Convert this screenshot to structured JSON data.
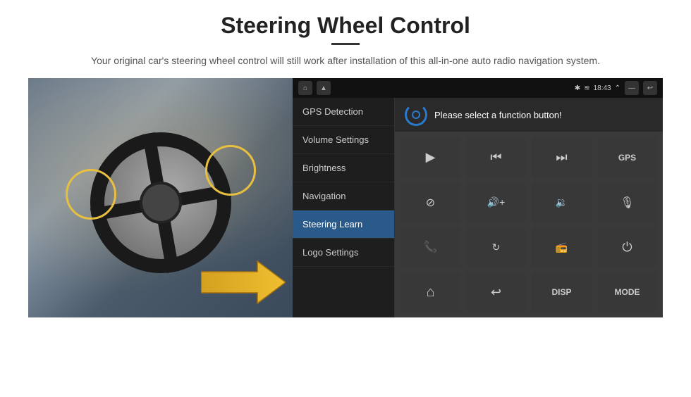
{
  "header": {
    "title": "Steering Wheel Control",
    "subtitle": "Your original car's steering wheel control will still work after installation of this all-in-one auto radio navigation system."
  },
  "display": {
    "statusBar": {
      "time": "18:43",
      "icons": [
        "bluetooth",
        "wifi",
        "signal",
        "expand",
        "battery",
        "back"
      ]
    },
    "navIcons": [
      "home",
      "triangle",
      "square"
    ]
  },
  "menu": {
    "items": [
      {
        "label": "GPS Detection",
        "active": false
      },
      {
        "label": "Volume Settings",
        "active": false
      },
      {
        "label": "Brightness",
        "active": false
      },
      {
        "label": "Navigation",
        "active": false
      },
      {
        "label": "Steering Learn",
        "active": true
      },
      {
        "label": "Logo Settings",
        "active": false
      }
    ]
  },
  "functionPanel": {
    "title": "Please select a function button!",
    "buttons": [
      {
        "id": "play",
        "icon": "▶",
        "type": "icon"
      },
      {
        "id": "prev",
        "icon": "⏮",
        "type": "icon"
      },
      {
        "id": "next",
        "icon": "⏭",
        "type": "icon"
      },
      {
        "id": "gps",
        "icon": "GPS",
        "type": "text"
      },
      {
        "id": "mute",
        "icon": "🚫",
        "type": "icon"
      },
      {
        "id": "vol-up",
        "icon": "🔊+",
        "type": "icon"
      },
      {
        "id": "vol-down",
        "icon": "🔉",
        "type": "icon"
      },
      {
        "id": "mic",
        "icon": "🎙",
        "type": "icon"
      },
      {
        "id": "phone",
        "icon": "📞",
        "type": "icon"
      },
      {
        "id": "loop",
        "icon": "🔄",
        "type": "icon"
      },
      {
        "id": "radio",
        "icon": "📻",
        "type": "icon"
      },
      {
        "id": "power",
        "icon": "⏻",
        "type": "icon"
      },
      {
        "id": "home",
        "icon": "⌂",
        "type": "icon"
      },
      {
        "id": "back",
        "icon": "↩",
        "type": "icon"
      },
      {
        "id": "disp",
        "icon": "DISP",
        "type": "text"
      },
      {
        "id": "mode",
        "icon": "MODE",
        "type": "text"
      }
    ]
  }
}
